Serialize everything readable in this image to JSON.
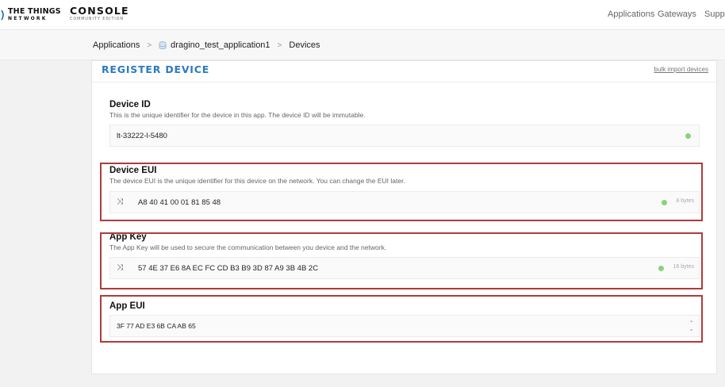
{
  "header": {
    "brand_line1": "THE THINGS",
    "brand_line2": "NETWORK",
    "console_title": "CONSOLE",
    "console_subtitle": "COMMUNITY EDITION",
    "nav": [
      "Applications",
      "Gateways",
      "Supp"
    ]
  },
  "breadcrumb": {
    "items": [
      "Applications",
      "dragino_test_application1",
      "Devices"
    ],
    "separator": ">"
  },
  "form": {
    "title": "REGISTER DEVICE",
    "bulk_import_label": "bulk import devices",
    "device_id": {
      "label": "Device ID",
      "help": "This is the unique identifier for the device in this app. The device ID will be immutable.",
      "value": "lt-33222-l-5480"
    },
    "device_eui": {
      "label": "Device EUI",
      "help": "The device EUI is the unique identifier for this device on the network. You can change the EUI later.",
      "value": "A8 40 41 00 01 81 85 48",
      "bytes": "8 bytes"
    },
    "app_key": {
      "label": "App Key",
      "help": "The App Key will be used to secure the communication between you device and the network.",
      "value": "57 4E 37 E6 8A EC FC CD B3 B9 3D 87 A9 3B 4B 2C",
      "bytes": "16 bytes"
    },
    "app_eui": {
      "label": "App EUI",
      "selected": "3F 77 AD E3 6B CA AB 65"
    }
  },
  "colors": {
    "accent": "#2b7bc0",
    "valid": "#8bd27a",
    "highlight": "#b23a3a"
  }
}
